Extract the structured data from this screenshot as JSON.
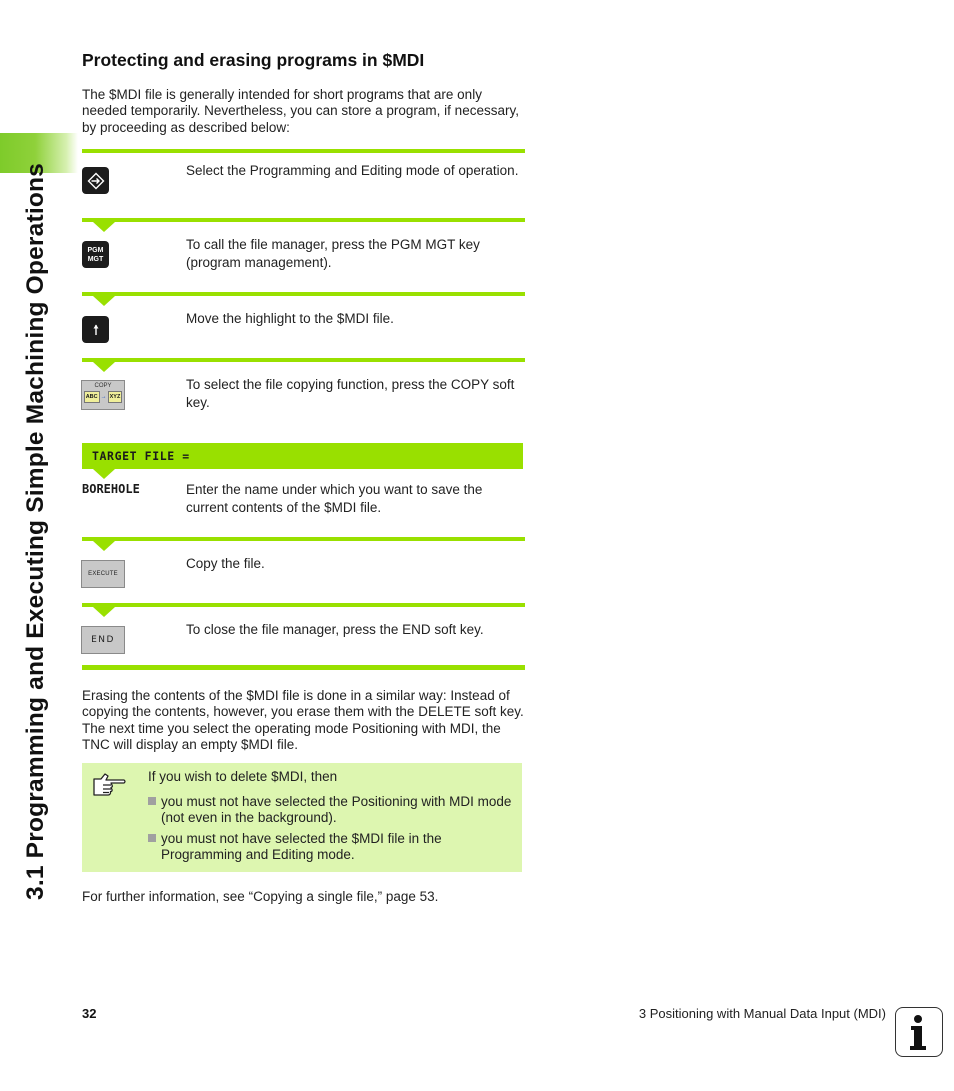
{
  "sidebar": {
    "chapter_title": "3.1 Programming and Executing Simple Machining Operations"
  },
  "section": {
    "heading": "Protecting and erasing programs in $MDI",
    "intro": "The $MDI file is generally intended for short programs that are only needed temporarily. Nevertheless, you can store a program, if necessary, by proceeding as described below:"
  },
  "steps": [
    {
      "key_icon": "programming-editing-mode-key",
      "text": "Select the Programming and Editing mode of operation."
    },
    {
      "key_icon": "pgm-mgt-key",
      "key_label_1": "PGM",
      "key_label_2": "MGT",
      "text": "To call the file manager, press the PGM MGT key (program management)."
    },
    {
      "key_icon": "arrow-up-key",
      "text": "Move the highlight to the $MDI file."
    },
    {
      "key_icon": "copy-soft-key",
      "key_label": "COPY",
      "from_label": "ABC",
      "to_label": "XYZ",
      "text": "To select the file copying function, press the COPY soft key."
    },
    {
      "dialog_prompt": "TARGET FILE =",
      "input_value": "BOREHOLE",
      "text": "Enter the name under which you want to save the current contents of the $MDI file."
    },
    {
      "key_icon": "execute-soft-key",
      "key_label": "EXECUTE",
      "text": "Copy the file."
    },
    {
      "key_icon": "end-soft-key",
      "key_label": "END",
      "text": "To close the file manager, press the END soft key."
    }
  ],
  "erase_paragraph": "Erasing the contents of the $MDI file is done in a similar way: Instead of copying the contents, however, you erase them with the DELETE soft key. The next time you select the operating mode Positioning with MDI, the TNC will display an empty $MDI file.",
  "note": {
    "icon": "pointing-hand-icon",
    "lead": "If you wish to delete $MDI, then",
    "bullets": [
      "you must not have selected the Positioning with MDI mode (not even in the background).",
      "you must not have selected the $MDI file in the Programming and Editing mode."
    ]
  },
  "cross_reference": "For further information, see “Copying a single file,” page 53.",
  "footer": {
    "page_number": "32",
    "chapter": "3 Positioning with Manual Data Input (MDI)",
    "info_icon": "info-icon"
  },
  "colors": {
    "accent_green": "#99e000",
    "note_background": "#ddf6b0",
    "side_band_green": "#7ecb2a"
  }
}
